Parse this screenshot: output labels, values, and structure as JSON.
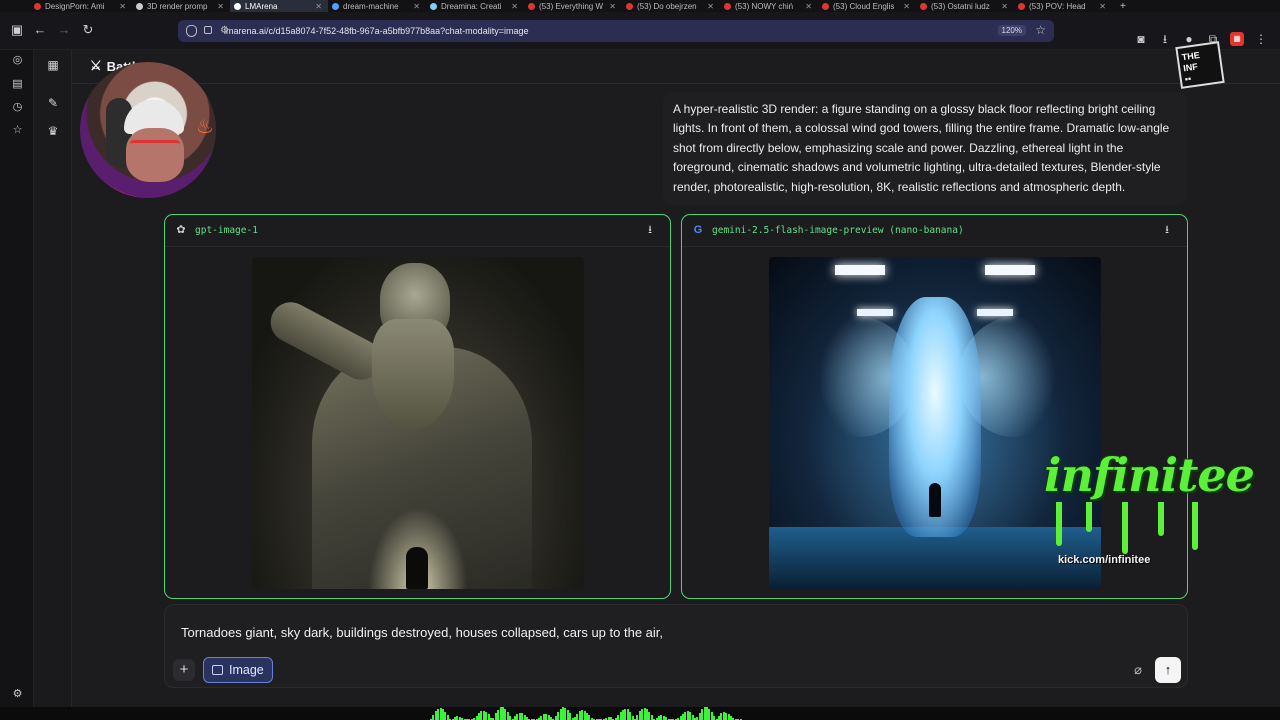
{
  "browser": {
    "tabs": [
      {
        "title": "DesignPorn: Ami",
        "fav": "#e5342b"
      },
      {
        "title": "3D render promp",
        "fav": "#cccccc"
      },
      {
        "title": "LMArena",
        "fav": "#ffffff",
        "active": true
      },
      {
        "title": "dream-machine",
        "fav": "#4aa3ff"
      },
      {
        "title": "Dreamina: Creati",
        "fav": "#7ed0ff"
      },
      {
        "title": "(53) Everything W",
        "fav": "#e5342b"
      },
      {
        "title": "(53) Do obejrzen",
        "fav": "#e5342b"
      },
      {
        "title": "(53) NOWY chiń",
        "fav": "#e5342b"
      },
      {
        "title": "(53) Cloud Englis",
        "fav": "#e5342b"
      },
      {
        "title": "(53) Ostatni ludz",
        "fav": "#e5342b"
      },
      {
        "title": "(53) POV: Head",
        "fav": "#e5342b"
      }
    ],
    "new_tab": "+",
    "url": "lmarena.ai/c/d15a8074-7f52-48fb-967a-a5bfb977b8aa?chat-modality=image",
    "zoom": "120%"
  },
  "header": {
    "title": "Battl"
  },
  "prompt_text": "A hyper-realistic 3D render: a figure standing on a glossy black floor reflecting bright ceiling lights. In front of them, a colossal wind god towers, filling the entire frame. Dramatic low-angle shot from directly below, emphasizing scale and power. Dazzling, ethereal light in the foreground, cinematic shadows and volumetric lighting, ultra-detailed textures, Blender-style render, photorealistic, high-resolution, 8K, realistic reflections and atmospheric depth.",
  "results": [
    {
      "model": "gpt-image-1",
      "icon": "openai-icon"
    },
    {
      "model": "gemini-2.5-flash-image-preview (nano-banana)",
      "icon": "google-icon"
    }
  ],
  "composer": {
    "text": "Tornadoes giant, sky dark, buildings destroyed, houses collapsed, cars up to the air,",
    "image_label": "Image"
  },
  "overlay": {
    "brand": "infinitee",
    "brand_url": "kick.com/infinitee"
  },
  "colors": {
    "accent_green": "#4ed37a",
    "model_text": "#5fe08a",
    "image_button": "#2a3260"
  }
}
